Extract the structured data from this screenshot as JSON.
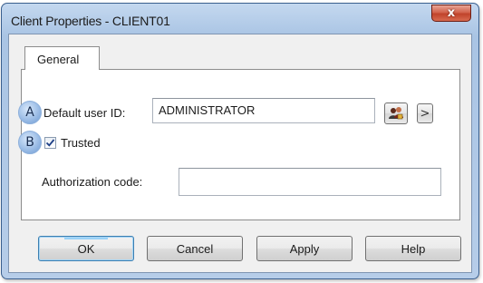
{
  "window": {
    "title": "Client Properties - CLIENT01",
    "close_glyph": "x"
  },
  "tabs": [
    {
      "label": "General",
      "active": true
    }
  ],
  "form": {
    "default_user_id": {
      "badge": "A",
      "label": "Default user ID:",
      "value": "ADMINISTRATOR",
      "lookup_icon": "users-lookup-icon",
      "next_glyph": ">"
    },
    "trusted": {
      "badge": "B",
      "label": "Trusted",
      "checked": true
    },
    "authorization_code": {
      "label": "Authorization code:",
      "value": ""
    }
  },
  "buttons": {
    "ok": "OK",
    "cancel": "Cancel",
    "apply": "Apply",
    "help": "Help"
  },
  "colors": {
    "frame": "#b6cde9",
    "close": "#c0432b",
    "badge": "#9cbde6"
  }
}
